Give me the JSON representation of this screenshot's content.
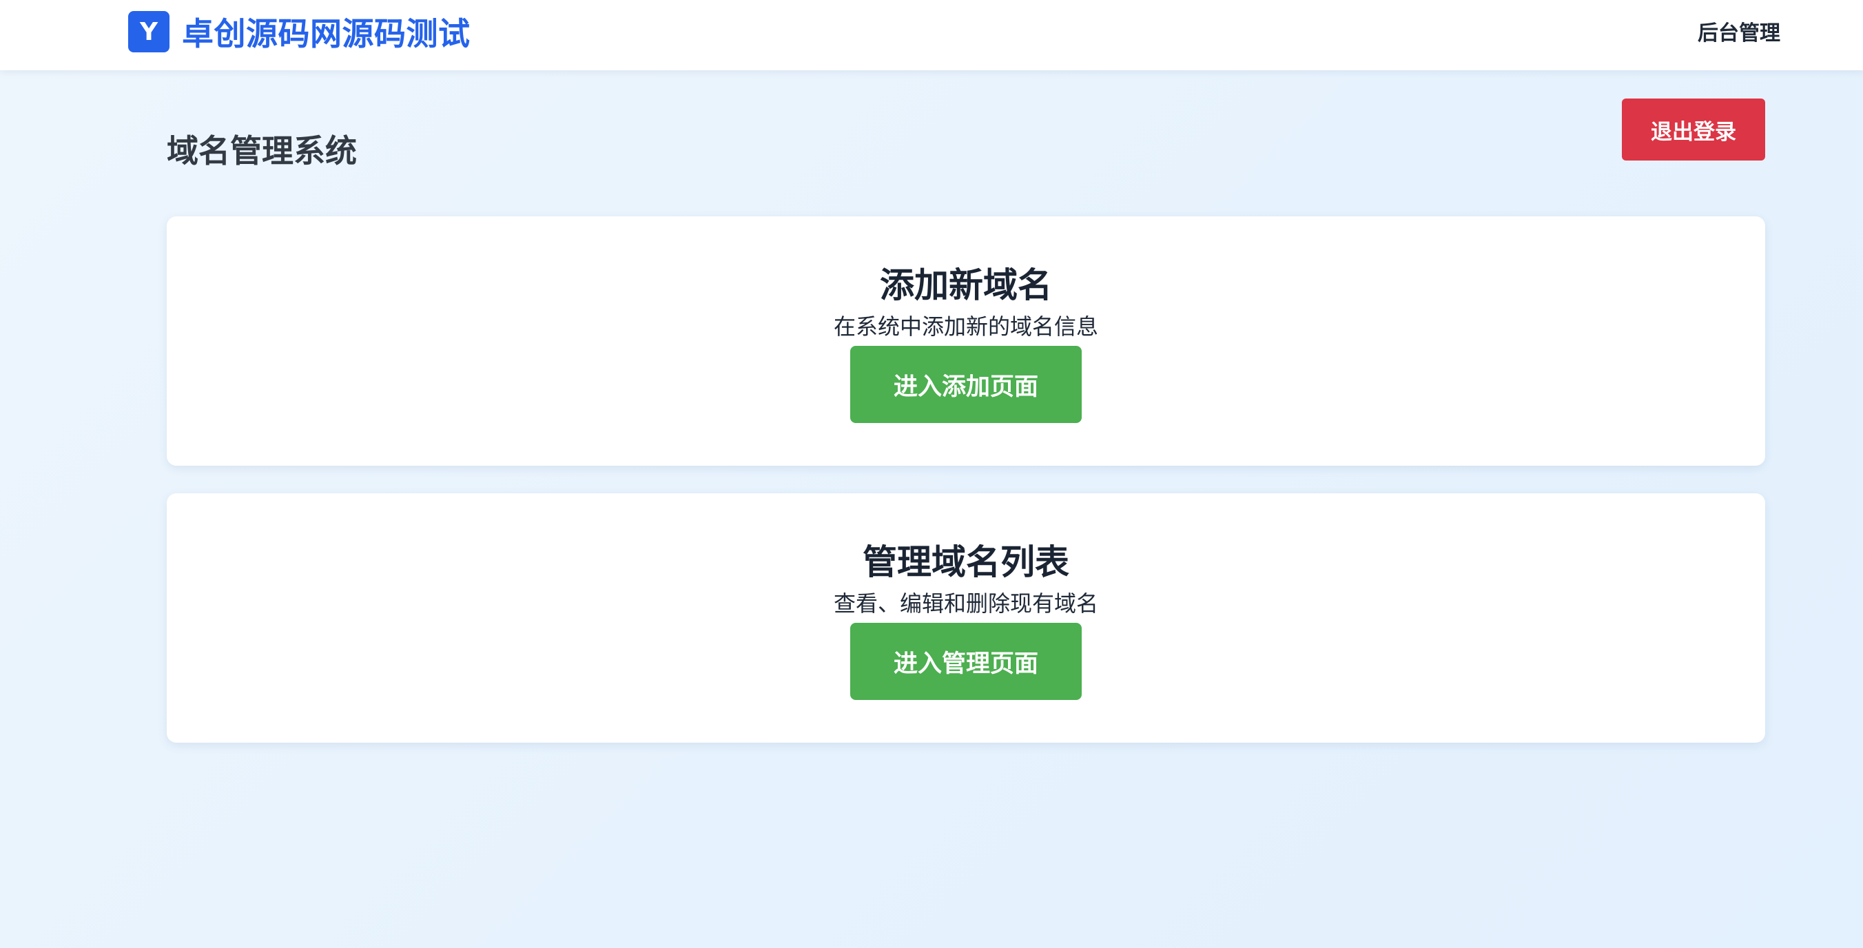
{
  "header": {
    "logo_letter": "Y",
    "site_name": "卓创源码网源码测试",
    "nav_admin_label": "后台管理",
    "brand_color": "#2563eb"
  },
  "page": {
    "title": "域名管理系统",
    "logout_label": "退出登录",
    "logout_color": "#dc3545"
  },
  "cards": [
    {
      "title": "添加新域名",
      "description": "在系统中添加新的域名信息",
      "button_label": "进入添加页面"
    },
    {
      "title": "管理域名列表",
      "description": "查看、编辑和删除现有域名",
      "button_label": "进入管理页面"
    }
  ],
  "button_color": "#4caf50"
}
